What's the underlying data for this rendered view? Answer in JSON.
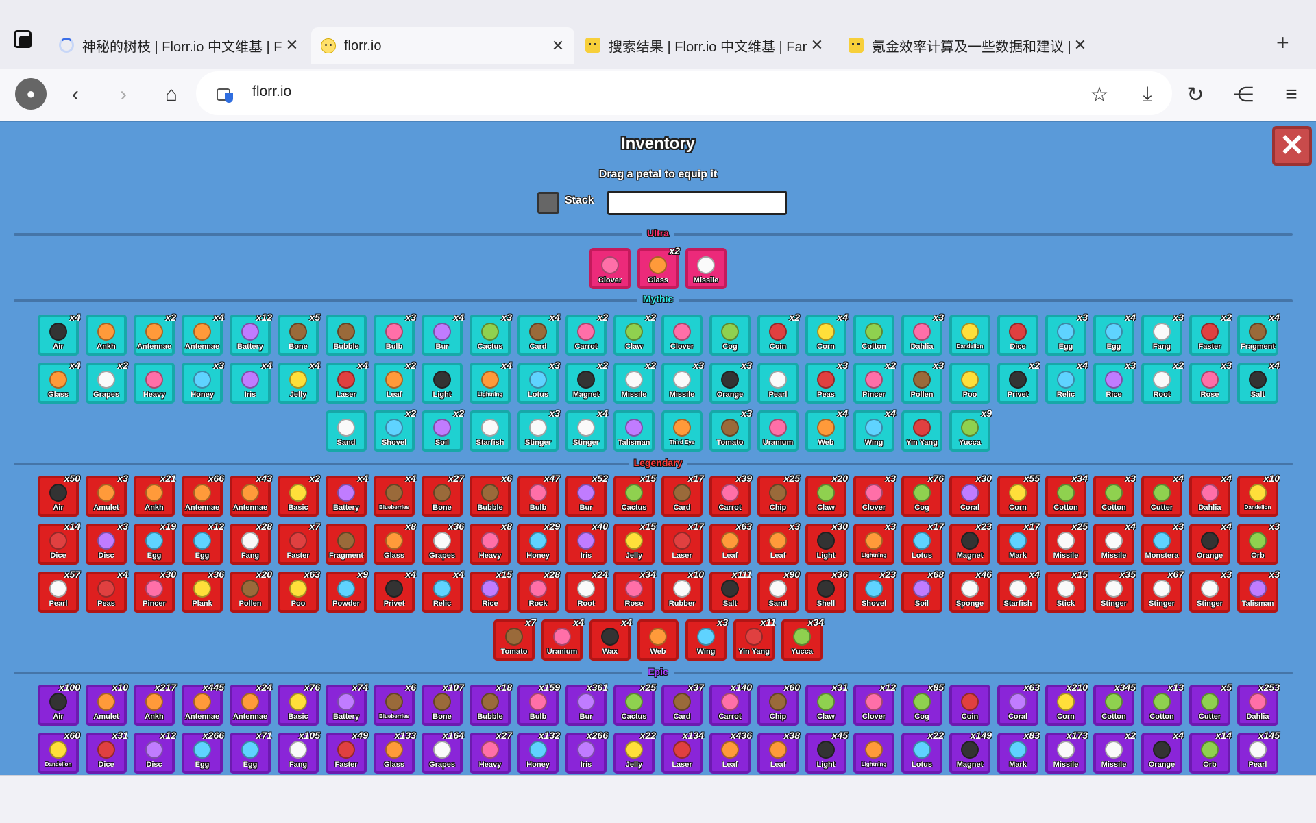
{
  "browser": {
    "tabs": [
      {
        "title": "神秘的树枝 | Florr.io 中文维基 | Fa",
        "favicon": "loading-spinner-icon",
        "active": false
      },
      {
        "title": "florr.io",
        "favicon": "smiley-favicon-icon",
        "active": true
      },
      {
        "title": "搜索结果 | Florr.io 中文维基 | Fand",
        "favicon": "cat-favicon-icon",
        "active": false
      },
      {
        "title": "氪金效率计算及一些数据和建议 | ",
        "favicon": "cat-favicon-icon",
        "active": false
      }
    ],
    "new_tab": "+",
    "url": "florr.io"
  },
  "inventory": {
    "title": "Inventory",
    "subtitle": "Drag a petal to equip it",
    "stack_label": "Stack",
    "stack_value": "",
    "close": "✕"
  },
  "colors": {
    "ultra": "#ec2a7a",
    "mythic": "#1fd1d1",
    "legendary": "#de1f1f",
    "epic": "#8a25d8",
    "background": "#5a9ad9"
  },
  "sections": [
    {
      "id": "ultra",
      "label": "Ultra",
      "label_color": "#ff2e6c",
      "rows": [
        [
          [
            "Clover",
            ""
          ],
          [
            "Glass",
            "x2"
          ],
          [
            "Missile",
            ""
          ]
        ]
      ]
    },
    {
      "id": "mythic",
      "label": "Mythic",
      "label_color": "#2fe5e5",
      "rows": [
        [
          [
            "Air",
            "x4"
          ],
          [
            "Ankh",
            ""
          ],
          [
            "Antennae",
            "x2"
          ],
          [
            "Antennae",
            "x4"
          ],
          [
            "Battery",
            "x12"
          ],
          [
            "Bone",
            "x5"
          ],
          [
            "Bubble",
            ""
          ],
          [
            "Bulb",
            "x3"
          ],
          [
            "Bur",
            "x4"
          ],
          [
            "Cactus",
            "x3"
          ],
          [
            "Card",
            "x4"
          ],
          [
            "Carrot",
            "x2"
          ],
          [
            "Claw",
            "x2"
          ],
          [
            "Clover",
            ""
          ],
          [
            "Cog",
            ""
          ],
          [
            "Coin",
            "x2"
          ],
          [
            "Corn",
            "x4"
          ],
          [
            "Cotton",
            ""
          ],
          [
            "Dahlia",
            "x3"
          ],
          [
            "Dandelion",
            ""
          ],
          [
            "Dice",
            ""
          ],
          [
            "Egg",
            "x3"
          ],
          [
            "Egg",
            "x4"
          ],
          [
            "Fang",
            "x3"
          ],
          [
            "Faster",
            "x2"
          ],
          [
            "Fragment",
            "x4"
          ]
        ],
        [
          [
            "Glass",
            "x4"
          ],
          [
            "Grapes",
            "x2"
          ],
          [
            "Heavy",
            ""
          ],
          [
            "Honey",
            "x3"
          ],
          [
            "Iris",
            "x4"
          ],
          [
            "Jelly",
            "x4"
          ],
          [
            "Laser",
            "x4"
          ],
          [
            "Leaf",
            "x2"
          ],
          [
            "Light",
            ""
          ],
          [
            "Lightning",
            "x4"
          ],
          [
            "Lotus",
            "x3"
          ],
          [
            "Magnet",
            "x2"
          ],
          [
            "Missile",
            "x2"
          ],
          [
            "Missile",
            "x3"
          ],
          [
            "Orange",
            "x3"
          ],
          [
            "Pearl",
            ""
          ],
          [
            "Peas",
            "x3"
          ],
          [
            "Pincer",
            "x2"
          ],
          [
            "Pollen",
            "x3"
          ],
          [
            "Poo",
            ""
          ],
          [
            "Privet",
            "x2"
          ],
          [
            "Relic",
            "x4"
          ],
          [
            "Rice",
            "x3"
          ],
          [
            "Root",
            "x2"
          ],
          [
            "Rose",
            "x3"
          ],
          [
            "Salt",
            "x4"
          ]
        ],
        [
          [
            "Sand",
            ""
          ],
          [
            "Shovel",
            "x2"
          ],
          [
            "Soil",
            "x2"
          ],
          [
            "Starfish",
            ""
          ],
          [
            "Stinger",
            "x3"
          ],
          [
            "Stinger",
            "x4"
          ],
          [
            "Talisman",
            ""
          ],
          [
            "Third Eye",
            ""
          ],
          [
            "Tomato",
            "x3"
          ],
          [
            "Uranium",
            ""
          ],
          [
            "Web",
            "x4"
          ],
          [
            "Wing",
            "x4"
          ],
          [
            "Yin Yang",
            ""
          ],
          [
            "Yucca",
            "x9"
          ]
        ]
      ]
    },
    {
      "id": "legendary",
      "label": "Legendary",
      "label_color": "#ff3a3a",
      "rows": [
        [
          [
            "Air",
            "x50"
          ],
          [
            "Amulet",
            "x3"
          ],
          [
            "Ankh",
            "x21"
          ],
          [
            "Antennae",
            "x66"
          ],
          [
            "Antennae",
            "x43"
          ],
          [
            "Basic",
            "x2"
          ],
          [
            "Battery",
            "x4"
          ],
          [
            "Blueberries",
            "x4"
          ],
          [
            "Bone",
            "x27"
          ],
          [
            "Bubble",
            "x6"
          ],
          [
            "Bulb",
            "x47"
          ],
          [
            "Bur",
            "x52"
          ],
          [
            "Cactus",
            "x15"
          ],
          [
            "Card",
            "x17"
          ],
          [
            "Carrot",
            "x39"
          ],
          [
            "Chip",
            "x25"
          ],
          [
            "Claw",
            "x20"
          ],
          [
            "Clover",
            "x3"
          ],
          [
            "Cog",
            "x76"
          ],
          [
            "Coral",
            "x30"
          ],
          [
            "Corn",
            "x55"
          ],
          [
            "Cotton",
            "x34"
          ],
          [
            "Cotton",
            "x3"
          ],
          [
            "Cutter",
            "x4"
          ],
          [
            "Dahlia",
            "x4"
          ],
          [
            "Dandelion",
            "x10"
          ]
        ],
        [
          [
            "Dice",
            "x14"
          ],
          [
            "Disc",
            "x3"
          ],
          [
            "Egg",
            "x19"
          ],
          [
            "Egg",
            "x12"
          ],
          [
            "Fang",
            "x28"
          ],
          [
            "Faster",
            "x7"
          ],
          [
            "Fragment",
            ""
          ],
          [
            "Glass",
            "x8"
          ],
          [
            "Grapes",
            "x36"
          ],
          [
            "Heavy",
            "x8"
          ],
          [
            "Honey",
            "x29"
          ],
          [
            "Iris",
            "x40"
          ],
          [
            "Jelly",
            "x15"
          ],
          [
            "Laser",
            "x17"
          ],
          [
            "Leaf",
            "x63"
          ],
          [
            "Leaf",
            "x3"
          ],
          [
            "Light",
            "x30"
          ],
          [
            "Lightning",
            "x3"
          ],
          [
            "Lotus",
            "x17"
          ],
          [
            "Magnet",
            "x23"
          ],
          [
            "Mark",
            "x17"
          ],
          [
            "Missile",
            "x25"
          ],
          [
            "Missile",
            "x4"
          ],
          [
            "Monstera",
            "x3"
          ],
          [
            "Orange",
            "x4"
          ],
          [
            "Orb",
            "x3"
          ]
        ],
        [
          [
            "Pearl",
            "x57"
          ],
          [
            "Peas",
            "x4"
          ],
          [
            "Pincer",
            "x30"
          ],
          [
            "Plank",
            "x36"
          ],
          [
            "Pollen",
            "x20"
          ],
          [
            "Poo",
            "x63"
          ],
          [
            "Powder",
            "x9"
          ],
          [
            "Privet",
            "x4"
          ],
          [
            "Relic",
            "x4"
          ],
          [
            "Rice",
            "x15"
          ],
          [
            "Rock",
            "x28"
          ],
          [
            "Root",
            "x24"
          ],
          [
            "Rose",
            "x34"
          ],
          [
            "Rubber",
            "x10"
          ],
          [
            "Salt",
            "x111"
          ],
          [
            "Sand",
            "x90"
          ],
          [
            "Shell",
            "x36"
          ],
          [
            "Shovel",
            "x23"
          ],
          [
            "Soil",
            "x68"
          ],
          [
            "Sponge",
            "x46"
          ],
          [
            "Starfish",
            "x4"
          ],
          [
            "Stick",
            "x15"
          ],
          [
            "Stinger",
            "x35"
          ],
          [
            "Stinger",
            "x67"
          ],
          [
            "Stinger",
            "x3"
          ],
          [
            "Talisman",
            "x3"
          ]
        ],
        [
          [
            "Tomato",
            "x7"
          ],
          [
            "Uranium",
            "x4"
          ],
          [
            "Wax",
            "x4"
          ],
          [
            "Web",
            ""
          ],
          [
            "Wing",
            "x3"
          ],
          [
            "Yin Yang",
            "x11"
          ],
          [
            "Yucca",
            "x34"
          ]
        ]
      ]
    },
    {
      "id": "epic",
      "label": "Epic",
      "label_color": "#a540ff",
      "rows": [
        [
          [
            "Air",
            "x100"
          ],
          [
            "Amulet",
            "x10"
          ],
          [
            "Ankh",
            "x217"
          ],
          [
            "Antennae",
            "x445"
          ],
          [
            "Antennae",
            "x24"
          ],
          [
            "Basic",
            "x76"
          ],
          [
            "Battery",
            "x74"
          ],
          [
            "Blueberries",
            "x6"
          ],
          [
            "Bone",
            "x107"
          ],
          [
            "Bubble",
            "x18"
          ],
          [
            "Bulb",
            "x159"
          ],
          [
            "Bur",
            "x361"
          ],
          [
            "Cactus",
            "x25"
          ],
          [
            "Card",
            "x37"
          ],
          [
            "Carrot",
            "x140"
          ],
          [
            "Chip",
            "x60"
          ],
          [
            "Claw",
            "x31"
          ],
          [
            "Clover",
            "x12"
          ],
          [
            "Cog",
            "x85"
          ],
          [
            "Coin",
            ""
          ],
          [
            "Coral",
            "x63"
          ],
          [
            "Corn",
            "x210"
          ],
          [
            "Cotton",
            "x345"
          ],
          [
            "Cotton",
            "x13"
          ],
          [
            "Cutter",
            "x5"
          ],
          [
            "Dahlia",
            "x253"
          ]
        ],
        [
          [
            "Dandelion",
            "x60"
          ],
          [
            "Dice",
            "x31"
          ],
          [
            "Disc",
            "x12"
          ],
          [
            "Egg",
            "x266"
          ],
          [
            "Egg",
            "x71"
          ],
          [
            "Fang",
            "x105"
          ],
          [
            "Faster",
            "x49"
          ],
          [
            "Glass",
            "x133"
          ],
          [
            "Grapes",
            "x164"
          ],
          [
            "Heavy",
            "x27"
          ],
          [
            "Honey",
            "x132"
          ],
          [
            "Iris",
            "x266"
          ],
          [
            "Jelly",
            "x22"
          ],
          [
            "Laser",
            "x134"
          ],
          [
            "Leaf",
            "x436"
          ],
          [
            "Leaf",
            "x38"
          ],
          [
            "Light",
            "x45"
          ],
          [
            "Lightning",
            ""
          ],
          [
            "Lotus",
            "x22"
          ],
          [
            "Magnet",
            "x149"
          ],
          [
            "Mark",
            "x83"
          ],
          [
            "Missile",
            "x173"
          ],
          [
            "Missile",
            "x2"
          ],
          [
            "Orange",
            "x4"
          ],
          [
            "Orb",
            "x14"
          ],
          [
            "Pearl",
            "x145"
          ]
        ]
      ]
    }
  ]
}
